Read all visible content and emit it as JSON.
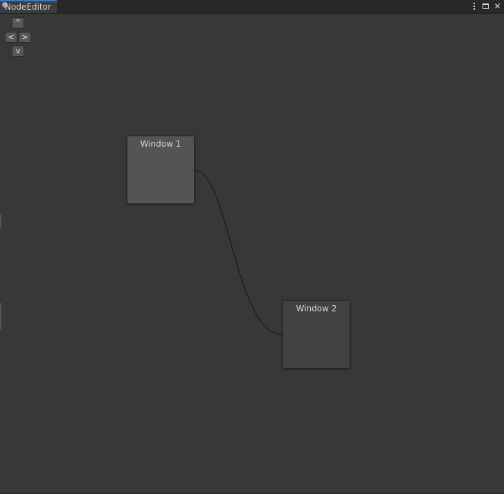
{
  "window": {
    "tab_title": "NodeEditor",
    "tab_accent": "#3a79bb",
    "tab_icon_color": "#a79bd6"
  },
  "titlebar_icons": [
    "more-vert-icon",
    "maximize-icon",
    "close-icon"
  ],
  "titlebar_close_glyph": "✕",
  "nav_buttons": {
    "up": "^",
    "left": "<",
    "right": ">",
    "down": "v"
  },
  "nodes": [
    {
      "id": "window-1",
      "title": "Window 1",
      "color": "#545454"
    },
    {
      "id": "window-2",
      "title": "Window 2",
      "color": "#424242"
    }
  ],
  "connections": [
    {
      "from": "Window 1",
      "to": "Window 2"
    }
  ],
  "colors": {
    "canvas_bg": "#383838",
    "tabstrip_bg": "#282828",
    "connection": "#1c1c1c"
  }
}
